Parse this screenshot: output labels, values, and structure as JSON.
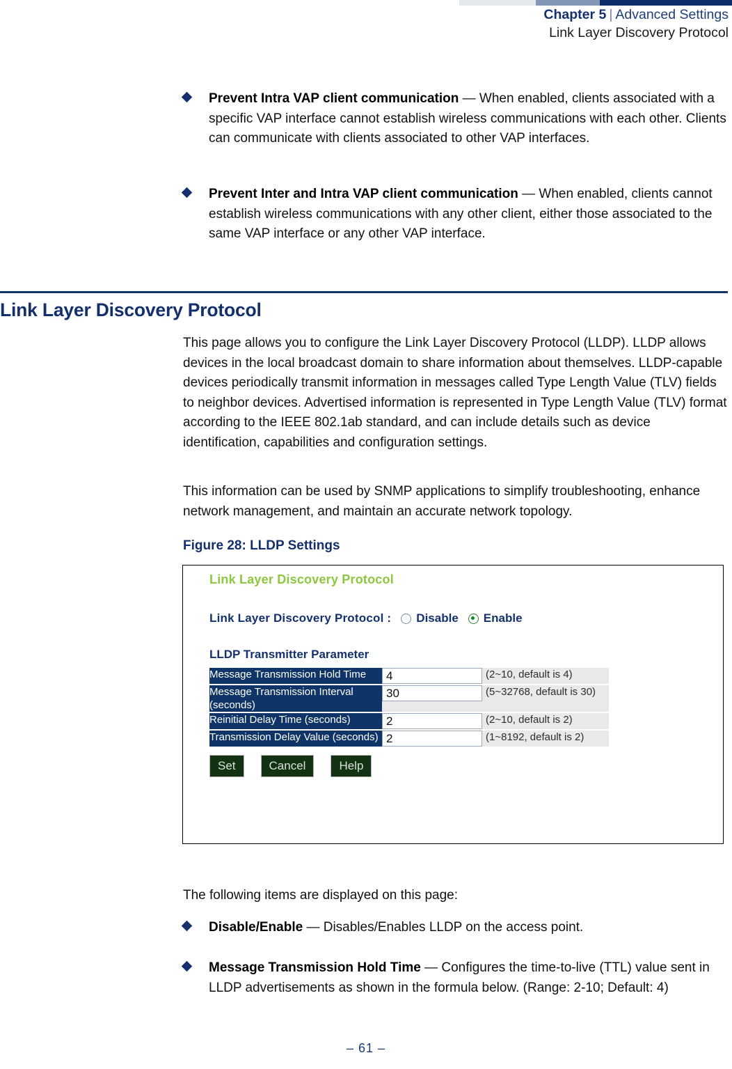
{
  "header": {
    "chapter": "Chapter 5",
    "separator": "|",
    "section": "Advanced Settings",
    "subtitle": "Link Layer Discovery Protocol"
  },
  "top_bullets": [
    {
      "term": "Prevent Intra VAP client communication",
      "body": " — When enabled, clients associated with a specific VAP interface cannot establish wireless communications with each other. Clients can communicate with clients associated to other VAP interfaces."
    },
    {
      "term": "Prevent Inter and Intra VAP client communication",
      "body": " — When enabled, clients cannot establish wireless communications with any other client, either those associated to the same VAP interface or any other VAP interface."
    }
  ],
  "section": {
    "heading": "Link Layer Discovery Protocol",
    "paragraph1": "This page allows you to configure the Link Layer Discovery Protocol (LLDP). LLDP allows devices in the local broadcast domain to share information about themselves. LLDP-capable devices periodically transmit information in messages called Type Length Value (TLV) fields to neighbor devices. Advertised information is represented in Type Length Value (TLV) format according to the IEEE 802.1ab standard, and can include details such as device identification, capabilities and configuration settings.",
    "paragraph2": "This information can be used by SNMP applications to simplify troubleshooting, enhance network management, and maintain an accurate network topology.",
    "figure_caption": "Figure 28:  LLDP Settings"
  },
  "figure": {
    "title": "Link Layer Discovery Protocol",
    "protocol_label": "Link Layer Discovery Protocol :",
    "radio_disable": "Disable",
    "radio_enable": "Enable",
    "radio_selected": "Enable",
    "subsection": "LLDP Transmitter Parameter",
    "rows": [
      {
        "label": "Message Transmission Hold Time",
        "value": "4",
        "hint": "(2~10, default is 4)"
      },
      {
        "label": "Message Transmission Interval (seconds)",
        "value": "30",
        "hint": "(5~32768, default is 30)"
      },
      {
        "label": "Reinitial Delay Time (seconds)",
        "value": "2",
        "hint": "(2~10, default is 2)"
      },
      {
        "label": "Transmission Delay Value (seconds)",
        "value": "2",
        "hint": "(1~8192, default is 2)"
      }
    ],
    "buttons": {
      "set": "Set",
      "cancel": "Cancel",
      "help": "Help"
    },
    "colors": {
      "title_green": "#8dc63f",
      "label_navy": "#0f3468",
      "button_green": "#133213"
    }
  },
  "bottom": {
    "intro": "The following items are displayed on this page:",
    "bullets": [
      {
        "term": "Disable/Enable",
        "body": " — Disables/Enables LLDP on the access point."
      },
      {
        "term": "Message Transmission Hold Time",
        "body": " — Configures the time-to-live (TTL) value sent in LLDP advertisements as shown in the formula below. (Range: 2-10; Default: 4)"
      }
    ]
  },
  "footer": {
    "page": "–  61  –"
  }
}
